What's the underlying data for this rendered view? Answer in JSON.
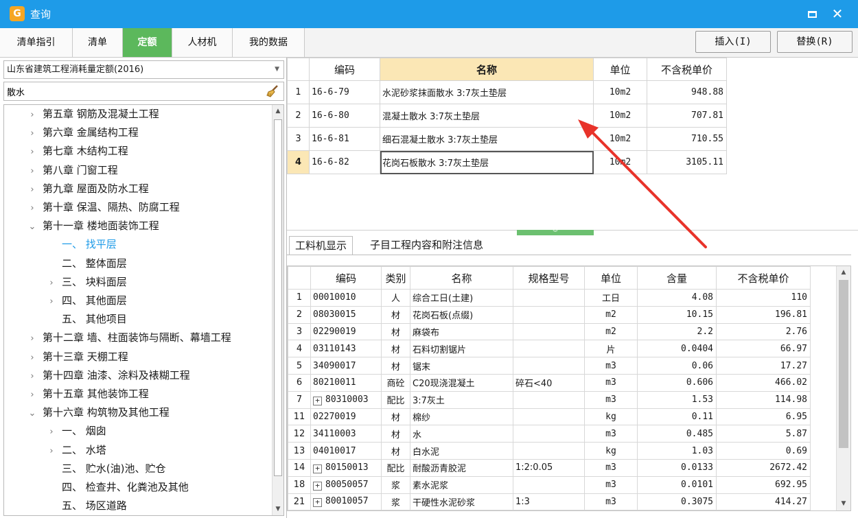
{
  "window": {
    "title": "查询",
    "app_icon_glyph": "G",
    "accent_color": "#1e9be8"
  },
  "tabs": [
    "清单指引",
    "清单",
    "定额",
    "人材机",
    "我的数据"
  ],
  "active_tab": "定额",
  "actions": {
    "insert_label": "插入(I)",
    "replace_label": "替换(R)"
  },
  "library": {
    "selected": "山东省建筑工程消耗量定额(2016)"
  },
  "search": {
    "value": "散水"
  },
  "tree": [
    {
      "label": "第五章  钢筋及混凝土工程",
      "level": 0,
      "expander": "collapsed"
    },
    {
      "label": "第六章  金属结构工程",
      "level": 0,
      "expander": "collapsed"
    },
    {
      "label": "第七章  木结构工程",
      "level": 0,
      "expander": "collapsed"
    },
    {
      "label": "第八章  门窗工程",
      "level": 0,
      "expander": "collapsed"
    },
    {
      "label": "第九章  屋面及防水工程",
      "level": 0,
      "expander": "collapsed"
    },
    {
      "label": "第十章  保温、隔热、防腐工程",
      "level": 0,
      "expander": "collapsed"
    },
    {
      "label": "第十一章  楼地面装饰工程",
      "level": 0,
      "expander": "expanded"
    },
    {
      "label": "一、  找平层",
      "level": 1,
      "expander": "none",
      "selected": true
    },
    {
      "label": "二、  整体面层",
      "level": 1,
      "expander": "none"
    },
    {
      "label": "三、  块料面层",
      "level": 1,
      "expander": "collapsed"
    },
    {
      "label": "四、  其他面层",
      "level": 1,
      "expander": "collapsed"
    },
    {
      "label": "五、  其他项目",
      "level": 1,
      "expander": "none"
    },
    {
      "label": "第十二章  墙、柱面装饰与隔断、幕墙工程",
      "level": 0,
      "expander": "collapsed"
    },
    {
      "label": "第十三章  天棚工程",
      "level": 0,
      "expander": "collapsed"
    },
    {
      "label": "第十四章  油漆、涂料及裱糊工程",
      "level": 0,
      "expander": "collapsed"
    },
    {
      "label": "第十五章  其他装饰工程",
      "level": 0,
      "expander": "collapsed"
    },
    {
      "label": "第十六章  构筑物及其他工程",
      "level": 0,
      "expander": "expanded"
    },
    {
      "label": "一、  烟囱",
      "level": 1,
      "expander": "collapsed"
    },
    {
      "label": "二、  水塔",
      "level": 1,
      "expander": "collapsed"
    },
    {
      "label": "三、  贮水(油)池、贮仓",
      "level": 1,
      "expander": "none"
    },
    {
      "label": "四、  检查井、化粪池及其他",
      "level": 1,
      "expander": "none"
    },
    {
      "label": "五、  场区道路",
      "level": 1,
      "expander": "none"
    }
  ],
  "quota_table": {
    "headers": [
      "",
      "编码",
      "名称",
      "单位",
      "不含税单价"
    ],
    "rows": [
      {
        "idx": "1",
        "code": "16-6-79",
        "name": "水泥砂浆抹面散水 3:7灰土垫层",
        "unit": "10m2",
        "price": "948.88"
      },
      {
        "idx": "2",
        "code": "16-6-80",
        "name": "混凝土散水 3:7灰土垫层",
        "unit": "10m2",
        "price": "707.81"
      },
      {
        "idx": "3",
        "code": "16-6-81",
        "name": "细石混凝土散水 3:7灰土垫层",
        "unit": "10m2",
        "price": "710.55"
      },
      {
        "idx": "4",
        "code": "16-6-82",
        "name": "花岗石板散水 3:7灰土垫层",
        "unit": "10m2",
        "price": "3105.11"
      }
    ],
    "selected_row": "4"
  },
  "detail_tabs": [
    "工料机显示",
    "子目工程内容和附注信息"
  ],
  "resource_table": {
    "headers": [
      "",
      "编码",
      "类别",
      "名称",
      "规格型号",
      "单位",
      "含量",
      "不含税单价"
    ],
    "rows": [
      {
        "idx": "1",
        "code": "00010010",
        "cat": "人",
        "name": "综合工日(土建)",
        "spec": "",
        "unit": "工日",
        "qty": "4.08",
        "price": "110",
        "expandable": false
      },
      {
        "idx": "2",
        "code": "08030015",
        "cat": "材",
        "name": "花岗石板(点缀)",
        "spec": "",
        "unit": "m2",
        "qty": "10.15",
        "price": "196.81",
        "expandable": false
      },
      {
        "idx": "3",
        "code": "02290019",
        "cat": "材",
        "name": "麻袋布",
        "spec": "",
        "unit": "m2",
        "qty": "2.2",
        "price": "2.76",
        "expandable": false
      },
      {
        "idx": "4",
        "code": "03110143",
        "cat": "材",
        "name": "石料切割锯片",
        "spec": "",
        "unit": "片",
        "qty": "0.0404",
        "price": "66.97",
        "expandable": false
      },
      {
        "idx": "5",
        "code": "34090017",
        "cat": "材",
        "name": "锯末",
        "spec": "",
        "unit": "m3",
        "qty": "0.06",
        "price": "17.27",
        "expandable": false
      },
      {
        "idx": "6",
        "code": "80210011",
        "cat": "商砼",
        "name": "C20现浇混凝土",
        "spec": "碎石<40",
        "unit": "m3",
        "qty": "0.606",
        "price": "466.02",
        "expandable": false
      },
      {
        "idx": "7",
        "code": "80310003",
        "cat": "配比",
        "name": "3:7灰土",
        "spec": "",
        "unit": "m3",
        "qty": "1.53",
        "price": "114.98",
        "expandable": true
      },
      {
        "idx": "11",
        "code": "02270019",
        "cat": "材",
        "name": "棉纱",
        "spec": "",
        "unit": "kg",
        "qty": "0.11",
        "price": "6.95",
        "expandable": false
      },
      {
        "idx": "12",
        "code": "34110003",
        "cat": "材",
        "name": "水",
        "spec": "",
        "unit": "m3",
        "qty": "0.485",
        "price": "5.87",
        "expandable": false
      },
      {
        "idx": "13",
        "code": "04010017",
        "cat": "材",
        "name": "白水泥",
        "spec": "",
        "unit": "kg",
        "qty": "1.03",
        "price": "0.69",
        "expandable": false
      },
      {
        "idx": "14",
        "code": "80150013",
        "cat": "配比",
        "name": "耐酸沥青胶泥",
        "spec": "1:2:0.05",
        "unit": "m3",
        "qty": "0.0133",
        "price": "2672.42",
        "expandable": true
      },
      {
        "idx": "18",
        "code": "80050057",
        "cat": "浆",
        "name": "素水泥浆",
        "spec": "",
        "unit": "m3",
        "qty": "0.0101",
        "price": "692.95",
        "expandable": true
      },
      {
        "idx": "21",
        "code": "80010057",
        "cat": "浆",
        "name": "干硬性水泥砂浆",
        "spec": "1:3",
        "unit": "m3",
        "qty": "0.3075",
        "price": "414.27",
        "expandable": true
      }
    ]
  },
  "annotation": {
    "color": "#e8332a"
  }
}
